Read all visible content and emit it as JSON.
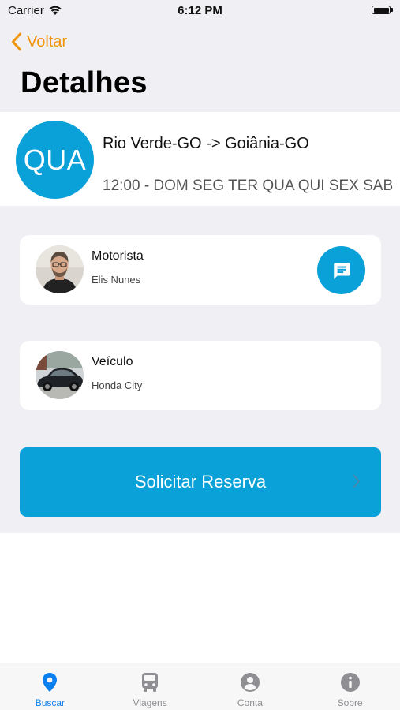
{
  "status_bar": {
    "carrier": "Carrier",
    "time": "6:12 PM"
  },
  "nav": {
    "back_label": "Voltar",
    "title": "Detalhes"
  },
  "route": {
    "day_badge": "QUA",
    "name": "Rio Verde-GO -> Goiânia-GO",
    "schedule": "12:00 - DOM SEG TER QUA QUI SEX SAB"
  },
  "driver": {
    "heading": "Motorista",
    "name": "Elis Nunes",
    "chat_icon": "chat-bubble-icon"
  },
  "vehicle": {
    "heading": "Veículo",
    "model": "Honda City"
  },
  "reserve": {
    "label": "Solicitar Reserva"
  },
  "tab_bar": {
    "tabs": [
      {
        "label": "Buscar",
        "icon": "location-pin-icon",
        "active": true
      },
      {
        "label": "Viagens",
        "icon": "bus-icon",
        "active": false
      },
      {
        "label": "Conta",
        "icon": "account-icon",
        "active": false
      },
      {
        "label": "Sobre",
        "icon": "info-icon",
        "active": false
      }
    ]
  },
  "colors": {
    "accent_blue": "#0aa0d8",
    "back_orange": "#f0950e",
    "tab_active": "#0a7ff0",
    "background": "#efeff4"
  }
}
